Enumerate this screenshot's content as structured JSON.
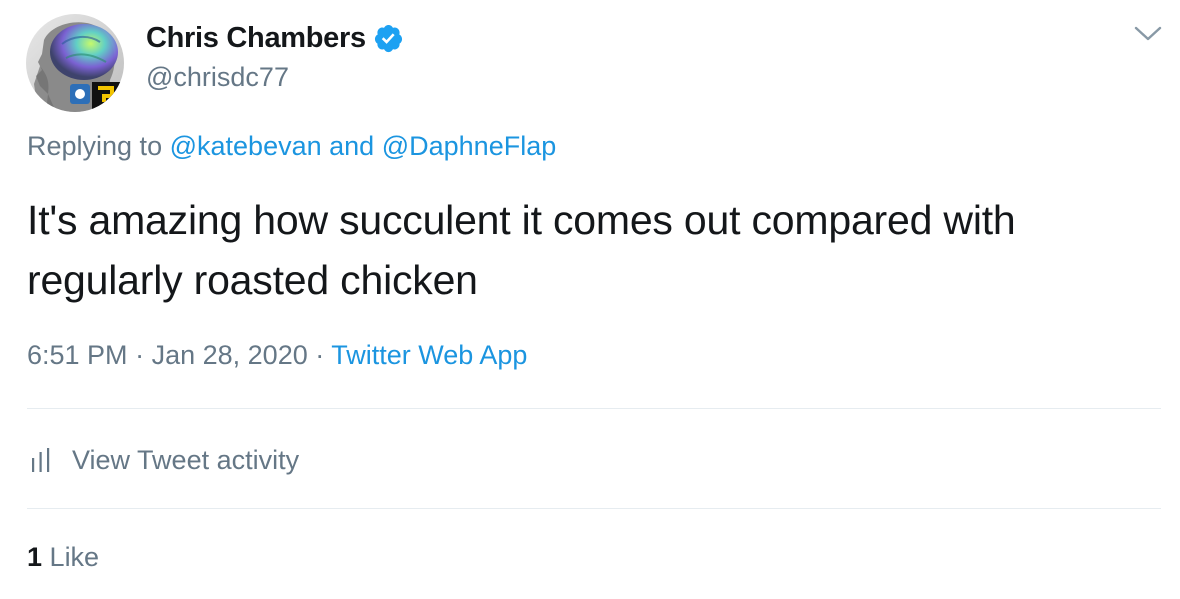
{
  "author": {
    "display_name": "Chris Chambers",
    "handle": "@chrisdc77",
    "verified": true
  },
  "reply": {
    "prefix": "Replying to",
    "mention_1": "@katebevan",
    "conjunction": "and",
    "mention_2": "@DaphneFlap"
  },
  "tweet": {
    "text_line_1": "It's amazing how succulent it comes out compared with",
    "text_line_2": "regularly roasted chicken"
  },
  "meta": {
    "time": "6:51 PM",
    "separator": "·",
    "date": "Jan 28, 2020",
    "source": "Twitter Web App"
  },
  "actions": {
    "view_activity": "View Tweet activity"
  },
  "stats": {
    "likes_count": "1",
    "likes_label": "Like"
  },
  "colors": {
    "link_blue": "#1b95e0",
    "secondary_text": "#657786",
    "primary_text": "#14171a",
    "divider": "#e6ecf0",
    "verified_blue": "#1da1f2"
  },
  "icons": {
    "verified": "verified-badge-icon",
    "caret": "chevron-down-icon",
    "activity": "bar-chart-icon"
  }
}
